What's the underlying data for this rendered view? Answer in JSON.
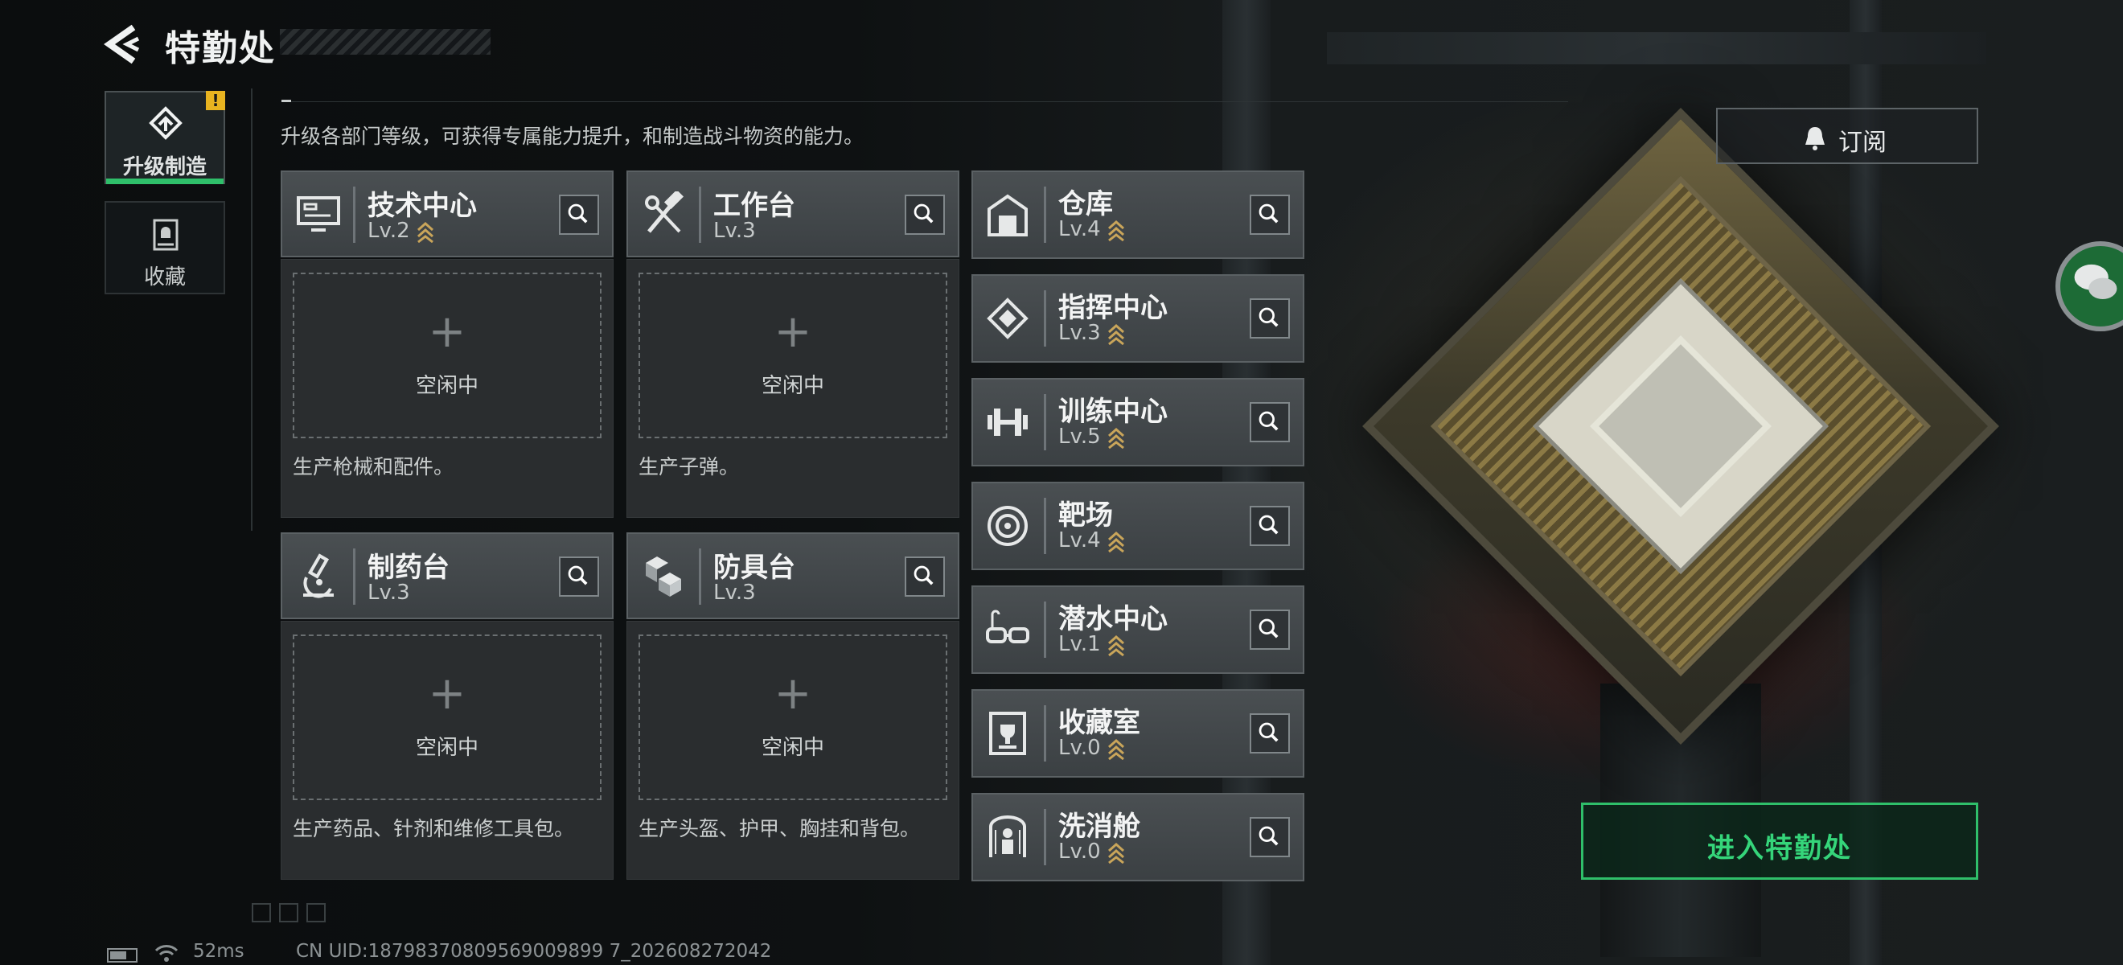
{
  "header": {
    "title": "特勤处"
  },
  "tabs": [
    {
      "label": "升级制造",
      "alert": "!",
      "active": true
    },
    {
      "label": "收藏",
      "active": false
    }
  ],
  "description": "升级各部门等级，可获得专属能力提升，和制造战斗物资的能力。",
  "subscribe": {
    "label": "订阅"
  },
  "enter": {
    "label": "进入特勤处"
  },
  "large_facilities": [
    {
      "name": "技术中心",
      "level": "Lv.2",
      "upgradable": true,
      "slot_status": "空闲中",
      "slot_icon": "+",
      "desc": "生产枪械和配件。",
      "icon": "computer-icon"
    },
    {
      "name": "工作台",
      "level": "Lv.3",
      "upgradable": false,
      "slot_status": "空闲中",
      "slot_icon": "+",
      "desc": "生产子弹。",
      "icon": "tools-icon"
    },
    {
      "name": "制药台",
      "level": "Lv.3",
      "upgradable": false,
      "slot_status": "空闲中",
      "slot_icon": "+",
      "desc": "生产药品、针剂和维修工具包。",
      "icon": "microscope-icon"
    },
    {
      "name": "防具台",
      "level": "Lv.3",
      "upgradable": false,
      "slot_status": "空闲中",
      "slot_icon": "+",
      "desc": "生产头盔、护甲、胸挂和背包。",
      "icon": "cubes-icon"
    }
  ],
  "small_facilities": [
    {
      "name": "仓库",
      "level": "Lv.4",
      "upgradable": true,
      "icon": "warehouse-icon"
    },
    {
      "name": "指挥中心",
      "level": "Lv.3",
      "upgradable": true,
      "icon": "command-icon"
    },
    {
      "name": "训练中心",
      "level": "Lv.5",
      "upgradable": true,
      "icon": "dumbbell-icon"
    },
    {
      "name": "靶场",
      "level": "Lv.4",
      "upgradable": true,
      "icon": "target-icon"
    },
    {
      "name": "潜水中心",
      "level": "Lv.1",
      "upgradable": true,
      "icon": "goggles-icon"
    },
    {
      "name": "收藏室",
      "level": "Lv.0",
      "upgradable": true,
      "icon": "trophy-case-icon"
    },
    {
      "name": "洗消舱",
      "level": "Lv.0",
      "upgradable": true,
      "icon": "decon-icon"
    }
  ],
  "status": {
    "ping": "52ms",
    "uid": "CN UID:18798370809569009899 7_202608272042"
  },
  "colors": {
    "accent": "#2fbf6a",
    "alert": "#e8b320",
    "upgrade": "#c9a55a"
  }
}
